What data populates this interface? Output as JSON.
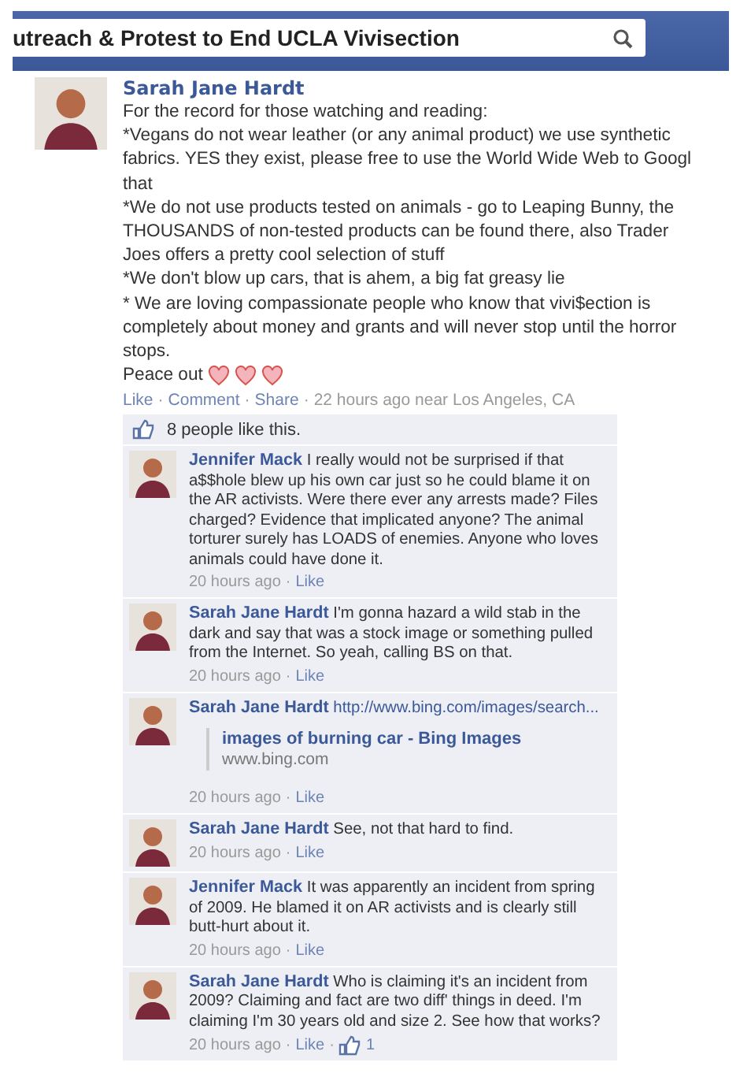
{
  "search": {
    "value": "utreach & Protest to End UCLA Vivisection"
  },
  "post": {
    "author": "Sarah Jane Hardt",
    "lines": [
      "For the record for those watching and reading:",
      "*Vegans do not wear leather (or any animal product) we use synthetic",
      "fabrics. YES they exist, please free to use the World Wide Web to Googl",
      "that",
      "*We do not use products tested on animals - go to Leaping Bunny, the",
      "THOUSANDS of non-tested products can be found there, also Trader",
      "Joes offers a pretty cool selection of stuff",
      "*We don't blow up cars, that is ahem, a big fat greasy lie",
      "* We are loving compassionate people who know that vivi$ection is",
      "completely about money and grants and will never stop until the horror",
      "stops.",
      "Peace out"
    ],
    "footer": [
      {
        "kind": "link",
        "text": "Like"
      },
      {
        "kind": "sep",
        "text": "·"
      },
      {
        "kind": "link",
        "text": "Comment"
      },
      {
        "kind": "sep",
        "text": "·"
      },
      {
        "kind": "link",
        "text": "Share"
      },
      {
        "kind": "sep",
        "text": "·"
      },
      {
        "kind": "time",
        "text": "22 hours ago near Los Angeles, CA"
      }
    ]
  },
  "likes": "8 people like this.",
  "comments": [
    {
      "author": "Jennifer Mack",
      "text": "I really would not be surprised if that a$$hole blew up his own car just so he could blame it on the AR activists. Were there ever any arrests made? Files charged? Evidence that implicated anyone? The animal torturer surely has LOADS of enemies. Anyone who loves animals could have done it.",
      "meta": [
        {
          "kind": "time",
          "text": "20 hours ago"
        },
        {
          "kind": "sep",
          "text": "·"
        },
        {
          "kind": "link",
          "text": "Like"
        }
      ]
    },
    {
      "author": "Sarah Jane Hardt",
      "text": "I'm gonna hazard a wild stab in the dark and say that was a stock image or something pulled from the Internet. So yeah, calling BS on that.",
      "meta": [
        {
          "kind": "time",
          "text": "20 hours ago"
        },
        {
          "kind": "sep",
          "text": "·"
        },
        {
          "kind": "link",
          "text": "Like"
        }
      ]
    },
    {
      "author": "Sarah Jane Hardt",
      "link": "http://www.bing.com/images/search...",
      "attachment": {
        "title": "images of burning car - Bing Images",
        "domain": "www.bing.com"
      },
      "meta": [
        {
          "kind": "time",
          "text": "20 hours ago"
        },
        {
          "kind": "sep",
          "text": "·"
        },
        {
          "kind": "link",
          "text": "Like"
        }
      ]
    },
    {
      "author": "Sarah Jane Hardt",
      "text": "See, not that hard to find.",
      "meta": [
        {
          "kind": "time",
          "text": "20 hours ago"
        },
        {
          "kind": "sep",
          "text": "·"
        },
        {
          "kind": "link",
          "text": "Like"
        }
      ]
    },
    {
      "author": "Jennifer Mack",
      "text": "It was apparently an incident from spring of 2009. He blamed it on AR activists and is clearly still butt-hurt about it.",
      "meta": [
        {
          "kind": "time",
          "text": "20 hours ago"
        },
        {
          "kind": "sep",
          "text": "·"
        },
        {
          "kind": "link",
          "text": "Like"
        }
      ]
    },
    {
      "author": "Sarah Jane Hardt",
      "text": "Who is claiming it's an incident from 2009? Claiming and fact are two diff' things in deed. I'm claiming I'm 30 years old and size 2. See how that works?",
      "meta": [
        {
          "kind": "time",
          "text": "20 hours ago"
        },
        {
          "kind": "sep",
          "text": "·"
        },
        {
          "kind": "link",
          "text": "Like"
        },
        {
          "kind": "sep",
          "text": "·"
        },
        {
          "kind": "likes",
          "text": "1"
        }
      ]
    }
  ]
}
